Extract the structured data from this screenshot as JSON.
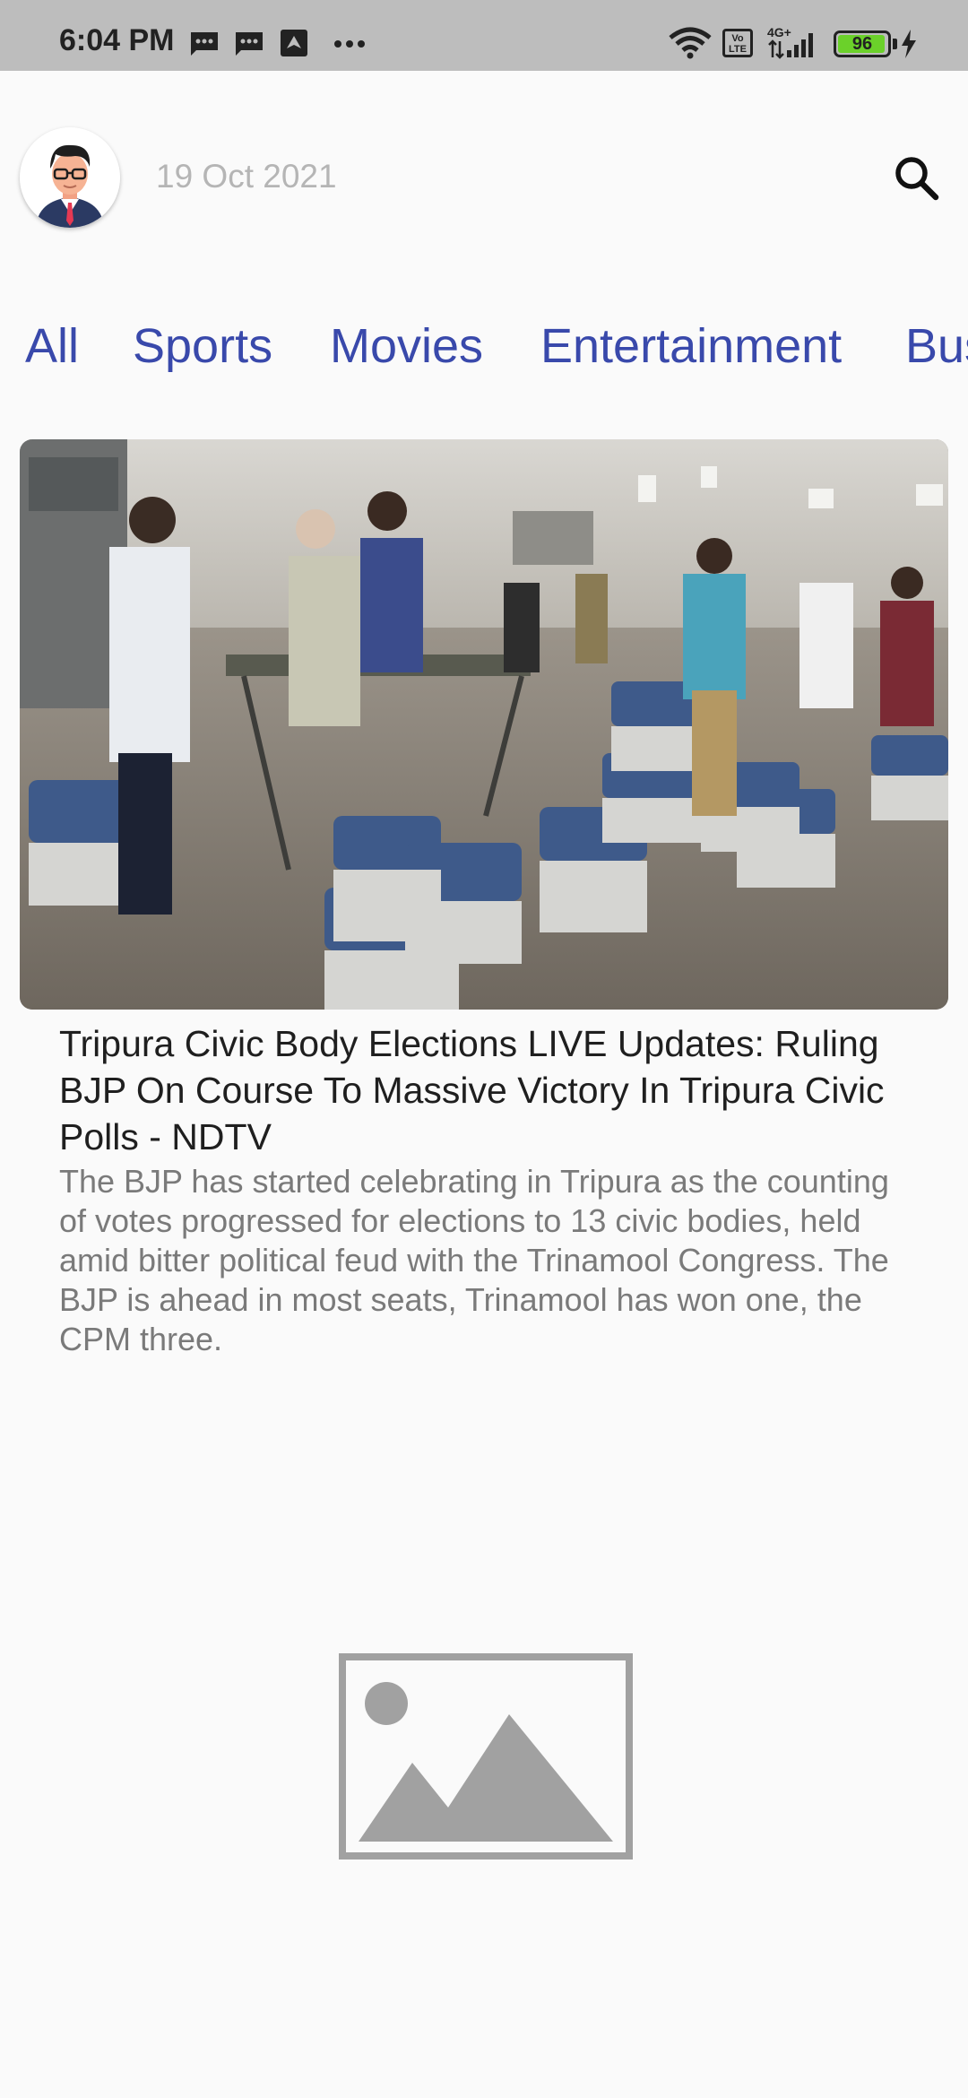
{
  "status_bar": {
    "time": "6:04 PM",
    "icons_left": [
      "message-icon",
      "message-icon",
      "navigation-icon",
      "more-icon"
    ],
    "icons_right": [
      "wifi-icon",
      "volte-icon",
      "signal-4g-icon",
      "battery-icon",
      "charging-icon"
    ],
    "network_label": "4G+",
    "volte_label": "Vo LTE",
    "battery_level": "96",
    "battery_color": "#6bd12a"
  },
  "header": {
    "avatar_icon": "avatar-icon",
    "date": "19 Oct 2021",
    "search_icon": "search-icon"
  },
  "tabs": [
    "All",
    "Sports",
    "Movies",
    "Entertainment",
    "Business"
  ],
  "accent_color": "#3949ab",
  "articles": [
    {
      "image_alt": "election-photo",
      "title": "Tripura Civic Body Elections LIVE Updates: Ruling BJP On Course To Massive Victory In Tripura Civic Polls - NDTV",
      "description": "The BJP has started celebrating in Tripura as the counting of votes progressed for elections to 13 civic bodies, held amid bitter political feud with the Trinamool Congress. The BJP is ahead in most seats, Trinamool has won one, the CPM three."
    }
  ],
  "placeholder_icon": "image-placeholder-icon"
}
